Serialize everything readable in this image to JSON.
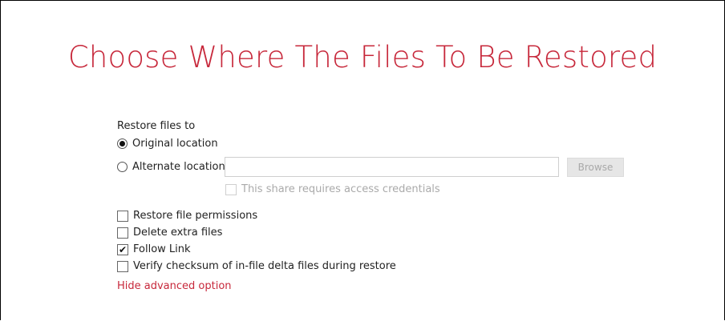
{
  "title": "Choose Where The Files To Be Restored",
  "restore_section": {
    "label": "Restore files to",
    "options": [
      {
        "label": "Original location",
        "selected": true
      },
      {
        "label": "Alternate location",
        "selected": false
      }
    ],
    "alternate_path_value": "",
    "browse_label": "Browse",
    "credentials_label": "This share requires access credentials",
    "credentials_checked": false
  },
  "advanced_options": [
    {
      "label": "Restore file permissions",
      "checked": false
    },
    {
      "label": "Delete extra files",
      "checked": false
    },
    {
      "label": "Follow Link",
      "checked": true
    },
    {
      "label": "Verify checksum of in-file delta files during restore",
      "checked": false
    }
  ],
  "hide_advanced_label": "Hide advanced option",
  "colors": {
    "accent": "#c7283b",
    "disabled_text": "#aaaaaa",
    "button_bg": "#e6e6e6"
  }
}
